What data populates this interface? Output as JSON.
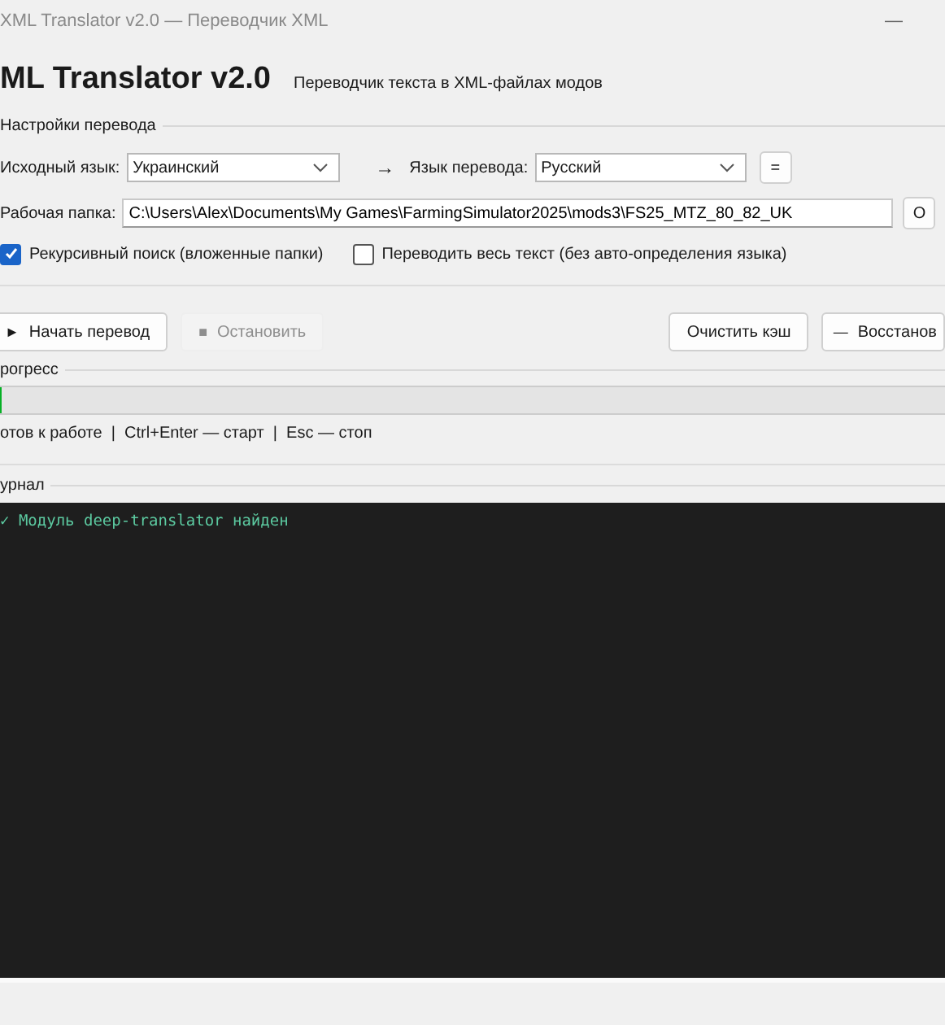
{
  "window": {
    "title": "XML Translator v2.0 — Переводчик XML",
    "minimize": "—"
  },
  "header": {
    "title": "ML Translator v2.0",
    "subtitle": "Переводчик текста в XML-файлах модов"
  },
  "settings": {
    "label": "Настройки перевода",
    "source_label": "Исходный язык:",
    "source_value": "Украинский",
    "arrow": "→",
    "target_label": "Язык перевода:",
    "target_value": "Русский",
    "swap": "=",
    "folder_label": "Рабочая папка:",
    "folder_value": "C:\\Users\\Alex\\Documents\\My Games\\FarmingSimulator2025\\mods3\\FS25_MTZ_80_82_UK",
    "browse": "О",
    "options": [
      {
        "label": "Рекурсивный поиск (вложенные папки)",
        "checked": true
      },
      {
        "label": "Переводить весь текст (без авто-определения языка)",
        "checked": false
      }
    ]
  },
  "actions_left": [
    {
      "label": "Начать перевод",
      "icon": "►",
      "disabled": false
    },
    {
      "label": "Остановить",
      "icon": "■",
      "disabled": true
    }
  ],
  "actions_right": [
    {
      "label": "Очистить кэш",
      "disabled": false
    },
    {
      "label": "Восстанов",
      "icon": "—",
      "disabled": false
    }
  ],
  "progress": {
    "label": "рогресс",
    "level": 0,
    "status": "отов к работе  |  Ctrl+Enter — старт  |  Esc — стоп"
  },
  "log": {
    "label": "урнал",
    "lines": [
      "✓ Модуль deep-translator найден"
    ]
  }
}
